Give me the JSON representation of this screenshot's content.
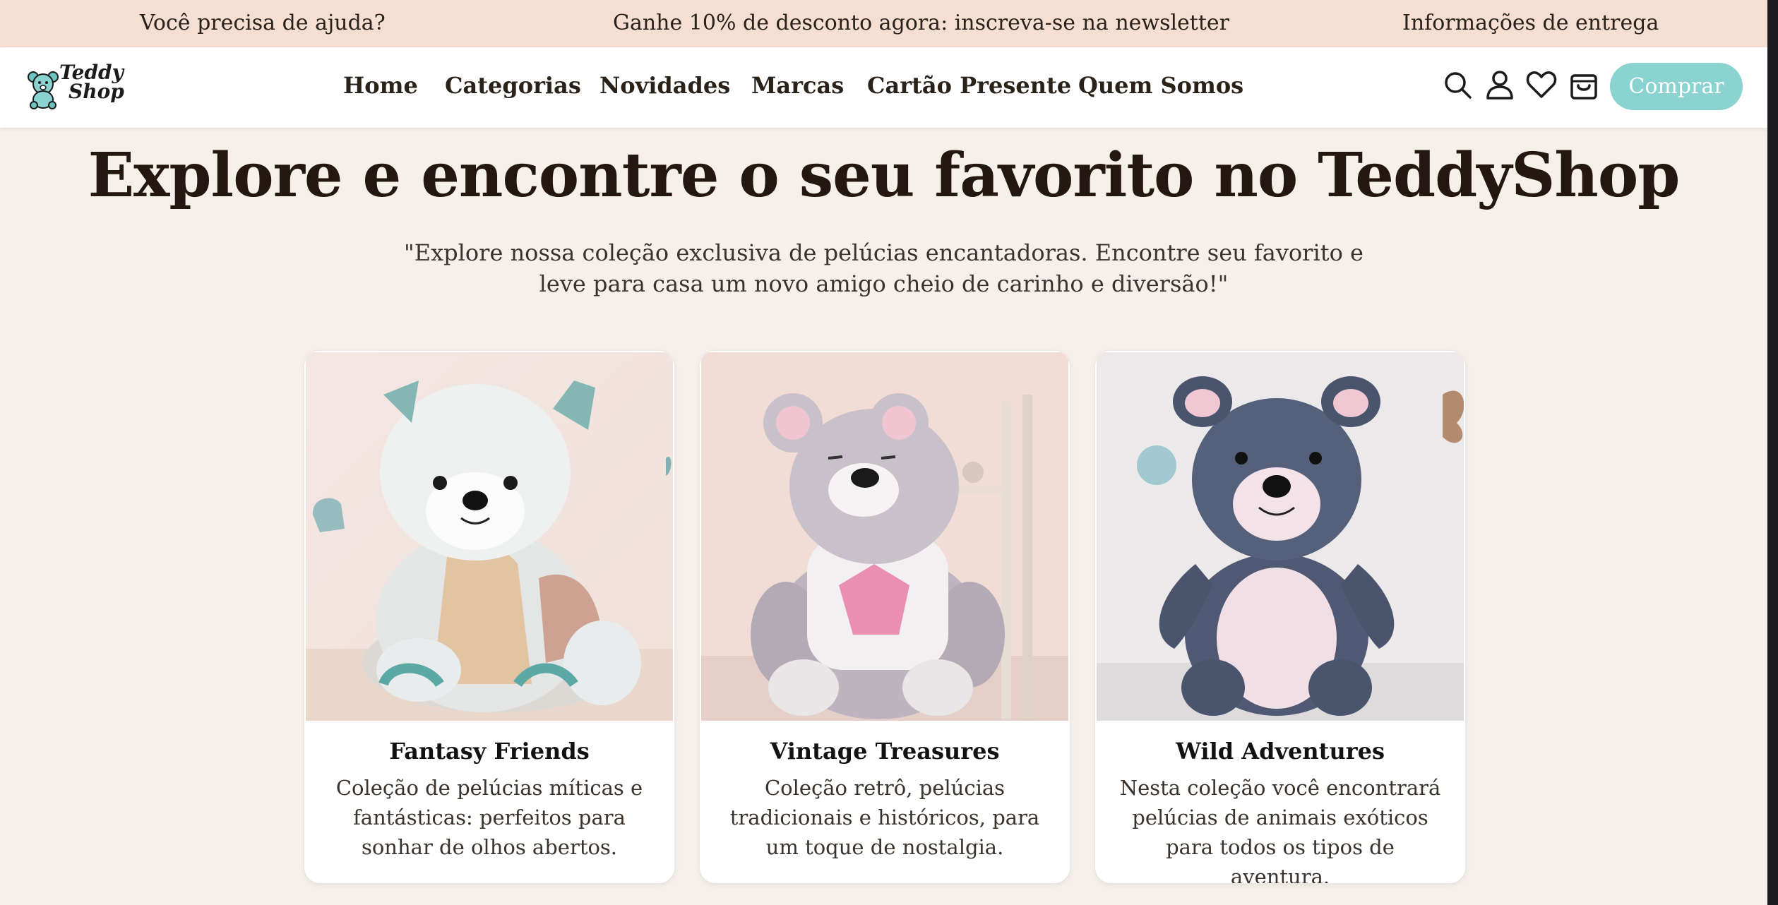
{
  "topbar": {
    "help": "Você precisa de ajuda?",
    "promo": "Ganhe 10% de desconto agora: inscreva-se na newsletter",
    "delivery": "Informações de entrega"
  },
  "brand": {
    "line1": "Teddy",
    "line2": "Shop"
  },
  "nav": {
    "links": [
      "Home",
      "Categorias",
      "Novidades",
      "Marcas",
      "Cartão Presente",
      "Quem Somos"
    ],
    "buy_label": "Comprar",
    "icons": [
      "search-icon",
      "user-icon",
      "heart-icon",
      "shopping-bag-icon"
    ]
  },
  "hero": {
    "title": "Explore e encontre o seu favorito no TeddyShop",
    "subtitle": "\"Explore nossa coleção exclusiva de pelúcias encantadoras. Encontre seu favorito e leve para casa um novo amigo cheio de carinho e diversão!\""
  },
  "cards": [
    {
      "title": "Fantasy Friends",
      "description": "Coleção de pelúcias míticas e fantásticas: perfeitos para sonhar de olhos abertos."
    },
    {
      "title": "Vintage Treasures",
      "description": "Coleção retrô, pelúcias tradicionais e históricos, para um toque de nostalgia."
    },
    {
      "title": "Wild Adventures",
      "description": "Nesta coleção você encontrará pelúcias de animais exóticos para todos os tipos de aventura."
    }
  ],
  "colors": {
    "topbar_bg": "#f5dfd3",
    "page_bg": "#f6f0ea",
    "accent": "#8bd3d1",
    "text": "#23170f"
  }
}
